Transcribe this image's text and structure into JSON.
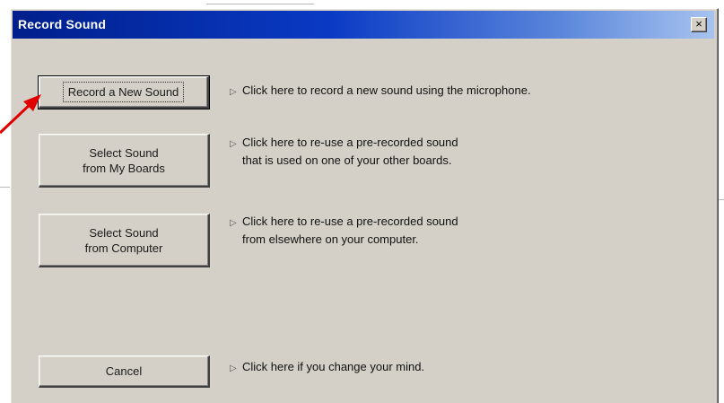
{
  "dialog": {
    "title": "Record Sound",
    "close_glyph": "×"
  },
  "options": [
    {
      "button_lines": [
        "Record a New Sound"
      ],
      "description_lines": [
        "Click here to record a new sound using the microphone."
      ]
    },
    {
      "button_lines": [
        "Select Sound",
        "from My Boards"
      ],
      "description_lines": [
        "Click here to re-use a pre-recorded sound",
        "that is used on one of your other boards."
      ]
    },
    {
      "button_lines": [
        "Select Sound",
        "from Computer"
      ],
      "description_lines": [
        "Click here to re-use a pre-recorded sound",
        "from elsewhere on your computer."
      ]
    },
    {
      "button_lines": [
        "Cancel"
      ],
      "description_lines": [
        "Click here if you change your mind."
      ]
    }
  ],
  "icons": {
    "bullet": "arrow-bullet-icon",
    "pointer": "red-arrow-pointer-icon",
    "close": "close-icon"
  },
  "colors": {
    "titlebar_start": "#001f8c",
    "titlebar_end": "#a8c3ef",
    "dialog_face": "#d4d0c8",
    "pointer_arrow": "#e00000"
  }
}
